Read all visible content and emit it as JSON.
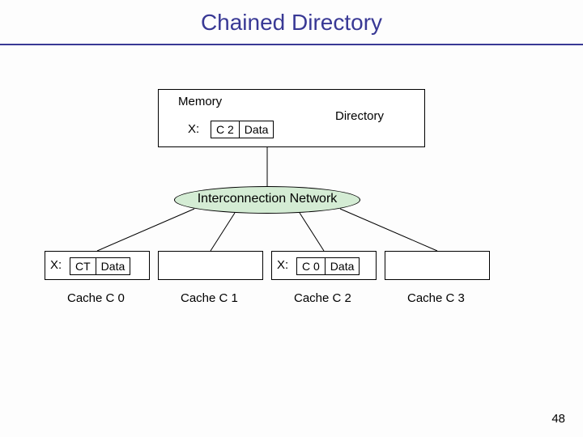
{
  "title": "Chained Directory",
  "memory": {
    "heading": "Memory",
    "directory_label": "Directory",
    "entry": {
      "key": "X:",
      "ptr": "C 2",
      "data": "Data"
    }
  },
  "network_label": "Interconnection Network",
  "caches": [
    {
      "name": "Cache C 0",
      "entry": {
        "key": "X:",
        "ptr": "CT",
        "data": "Data"
      }
    },
    {
      "name": "Cache C 1",
      "entry": null
    },
    {
      "name": "Cache C 2",
      "entry": {
        "key": "X:",
        "ptr": "C 0",
        "data": "Data"
      }
    },
    {
      "name": "Cache C 3",
      "entry": null
    }
  ],
  "page_number": "48"
}
